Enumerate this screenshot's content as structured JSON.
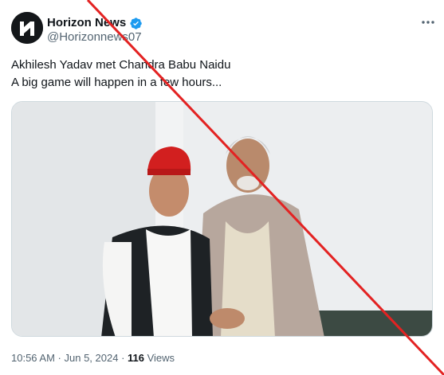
{
  "tweet": {
    "display_name": "Horizon News",
    "handle": "@Horizonnews07",
    "text_line_1": "Akhilesh Yadav met Chandra Babu Naidu",
    "text_line_2": "A big game will happen in a few hours...",
    "time": "10:56 AM",
    "date": "Jun 5, 2024",
    "separator": " · ",
    "views_count": "116",
    "views_label": " Views"
  },
  "icons": {
    "avatar": "horizon-news-logo",
    "verified": "verified-badge-icon",
    "more": "more-options-icon"
  },
  "colors": {
    "verified_blue": "#1d9bf0",
    "strike_red": "#e32222",
    "secondary_text": "#536471"
  }
}
